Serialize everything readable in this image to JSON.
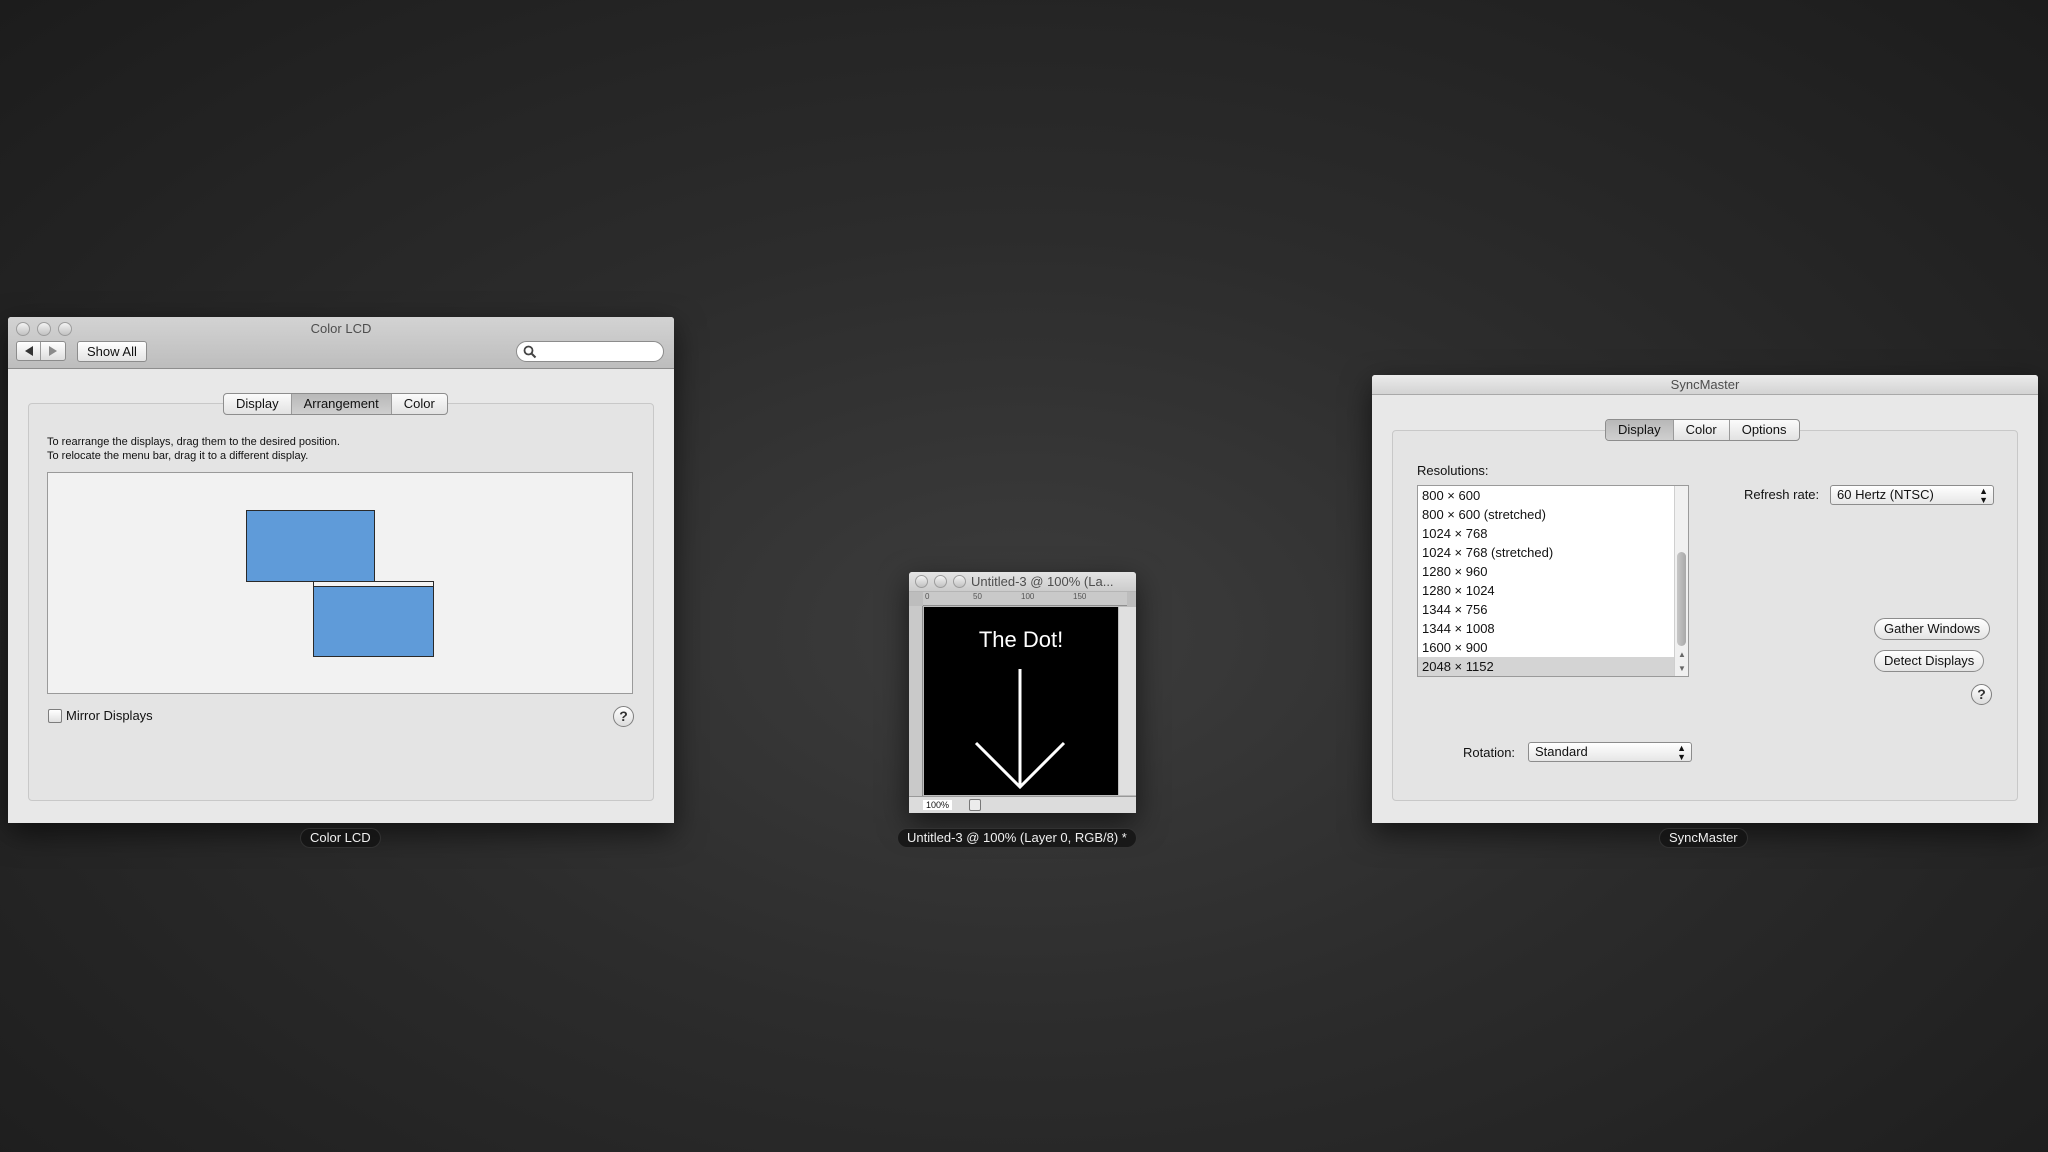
{
  "color_lcd_window": {
    "title": "Color LCD",
    "show_all": "Show All",
    "search_placeholder": "",
    "tabs": [
      "Display",
      "Arrangement",
      "Color"
    ],
    "active_tab": "Arrangement",
    "instructions": [
      "To rearrange the displays, drag them to the desired position.",
      "To relocate the menu bar, drag it to a different display."
    ],
    "mirror_displays": "Mirror Displays",
    "help": "?",
    "display_color": "#5f9bd9"
  },
  "photoshop_window": {
    "title": "Untitled-3 @ 100% (La...",
    "ruler_marks": [
      "0",
      "50",
      "100",
      "150"
    ],
    "canvas_text": "The Dot!",
    "zoom": "100%"
  },
  "syncmaster_window": {
    "title": "SyncMaster",
    "tabs": [
      "Display",
      "Color",
      "Options"
    ],
    "active_tab": "Display",
    "resolutions_label": "Resolutions:",
    "resolutions": [
      "800 × 600",
      "800 × 600 (stretched)",
      "1024 × 768",
      "1024 × 768 (stretched)",
      "1280 × 960",
      "1280 × 1024",
      "1344 × 756",
      "1344 × 1008",
      "1600 × 900",
      "2048 × 1152"
    ],
    "selected_resolution": "2048 × 1152",
    "refresh_label": "Refresh rate:",
    "refresh_value": "60 Hertz (NTSC)",
    "gather_windows": "Gather Windows",
    "detect_displays": "Detect Displays",
    "rotation_label": "Rotation:",
    "rotation_value": "Standard",
    "help": "?"
  },
  "window_labels": {
    "color_lcd": "Color LCD",
    "photoshop": "Untitled-3 @ 100% (Layer 0, RGB/8) *",
    "syncmaster": "SyncMaster"
  }
}
